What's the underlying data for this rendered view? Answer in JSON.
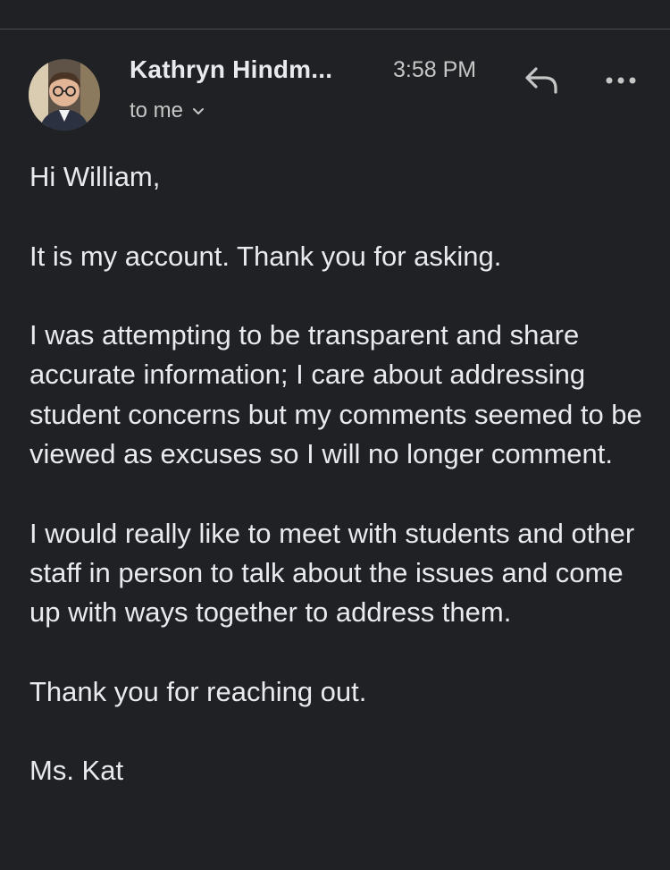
{
  "message": {
    "sender_name": "Kathryn Hindm...",
    "time": "3:58 PM",
    "recipient_label": "to me",
    "icons": {
      "avatar": "sender-avatar-photo",
      "reply": "reply-arrow-icon",
      "more": "more-horizontal-icon",
      "recipient_toggle": "chevron-down-icon"
    },
    "body_paragraphs": [
      "Hi William,",
      "It is my account. Thank you for asking.",
      "I was attempting to be transparent and share accurate information; I care about addressing student concerns but my comments seemed to be viewed as excuses so I will no longer comment.",
      "I would really like to meet with students and other staff in person to talk about the issues and come up with ways together to address them.",
      "Thank you for reaching out.",
      "Ms. Kat"
    ]
  },
  "colors": {
    "background": "#202124",
    "primary_text": "#e8eaed",
    "secondary_text": "#c4c7c5",
    "divider": "#4a4c50"
  }
}
